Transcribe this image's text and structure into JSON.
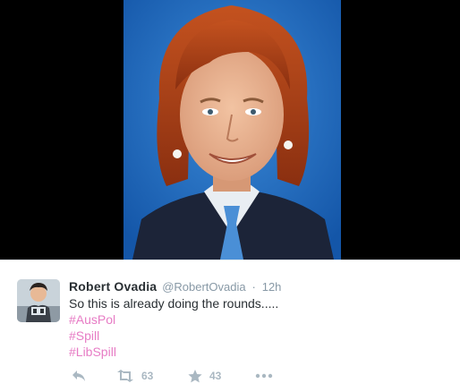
{
  "tweet": {
    "display_name": "Robert Ovadia",
    "screen_name": "@RobertOvadia",
    "separator": "·",
    "time": "12h",
    "text": "So this is already doing the rounds.....",
    "hashtags": [
      "#AusPol",
      "#Spill",
      "#LibSpill"
    ],
    "hashtag_color": "#e77cc5"
  },
  "actions": {
    "reply_icon": "reply-icon",
    "retweet_icon": "retweet-icon",
    "retweet_count": "63",
    "favorite_icon": "star-icon",
    "favorite_count": "43",
    "more_icon": "more-dots-icon"
  },
  "colors": {
    "media_background": "#000000",
    "photo_background": "#1f6fc4",
    "action_gray": "#aab8c2"
  }
}
